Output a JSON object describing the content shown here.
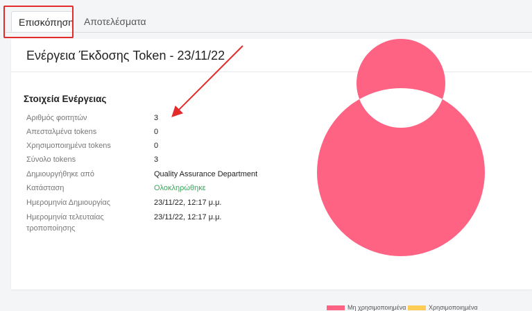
{
  "tabs": [
    {
      "label": "Επισκόπηση",
      "active": true
    },
    {
      "label": "Αποτελέσματα",
      "active": false
    }
  ],
  "card": {
    "title": "Ενέργεια Έκδοσης Token - 23/11/22",
    "section_title": "Στοιχεία Ενέργειας",
    "details": [
      {
        "label": "Αριθμός φοιτητών",
        "value": "3"
      },
      {
        "label": "Απεσταλμένα tokens",
        "value": "0"
      },
      {
        "label": "Χρησιμοποιημένα tokens",
        "value": "0"
      },
      {
        "label": "Σύνολο tokens",
        "value": "3"
      },
      {
        "label": "Δημιουργήθηκε από",
        "value": "Quality Assurance Department"
      },
      {
        "label": "Κατάσταση",
        "value": "Ολοκληρώθηκε"
      },
      {
        "label": "Ημερομηνία Δημιουργίας",
        "value": "23/11/22, 12:17 μ.μ."
      },
      {
        "label": "Ημερομηνία τελευταίας τροποποίησης",
        "value": "23/11/22, 12:17 μ.μ."
      }
    ]
  },
  "colors": {
    "unused": "#ff6384",
    "used": "#ffcd56",
    "status_completed": "#3aa65a",
    "highlight": "#e32b2b"
  },
  "chart_data": {
    "type": "pie",
    "variant": "doughnut",
    "categories": [
      "Μη χρησιμοποιημένα",
      "Χρησιμοποιημένα"
    ],
    "values": [
      3,
      0
    ],
    "legend": "bottom"
  }
}
